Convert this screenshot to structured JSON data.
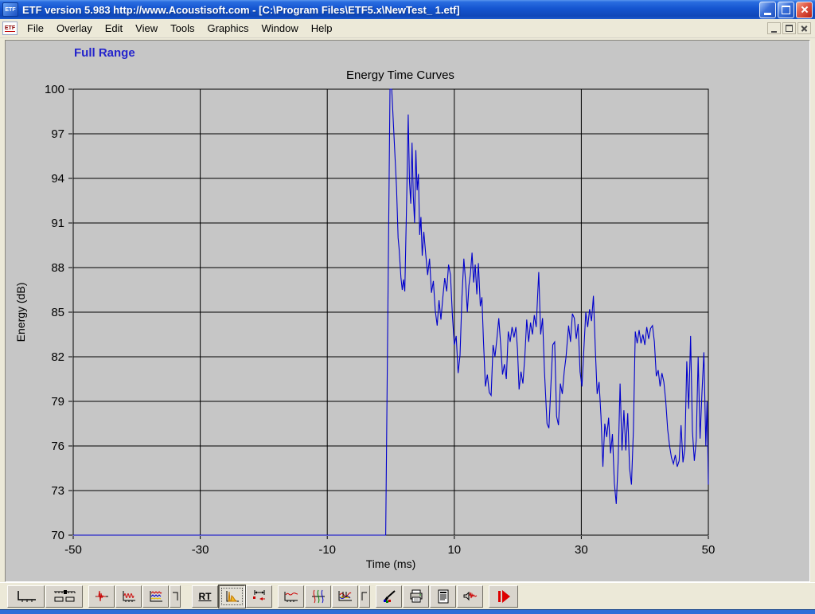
{
  "window": {
    "title": "ETF version 5.983 http://www.Acoustisoft.com - [C:\\Program Files\\ETF5.x\\NewTest_ 1.etf]",
    "icon_text": "ETF"
  },
  "menu": {
    "icon_text": "ETF",
    "items": [
      "File",
      "Overlay",
      "Edit",
      "View",
      "Tools",
      "Graphics",
      "Window",
      "Help"
    ]
  },
  "view_label": "Full Range",
  "chart_data": {
    "type": "line",
    "title": "Energy Time Curves",
    "xlabel": "Time (ms)",
    "ylabel": "Energy (dB)",
    "xlim": [
      -50,
      50
    ],
    "ylim": [
      70,
      100
    ],
    "xticks": [
      -50,
      -30,
      -10,
      10,
      30,
      50
    ],
    "yticks": [
      70,
      73,
      76,
      79,
      82,
      85,
      88,
      91,
      94,
      97,
      100
    ],
    "grid": true,
    "legend": "none",
    "line_color": "#0000cc",
    "series": [
      {
        "name": "Energy",
        "points": [
          [
            -50,
            70
          ],
          [
            -0.8,
            70
          ],
          [
            -0.12,
            100
          ],
          [
            0.15,
            100
          ],
          [
            0.5,
            96.9
          ],
          [
            0.9,
            93.4
          ],
          [
            1.15,
            90.0
          ],
          [
            1.3,
            89.3
          ],
          [
            1.6,
            87.3
          ],
          [
            1.8,
            86.5
          ],
          [
            2.0,
            87.2
          ],
          [
            2.2,
            86.4
          ],
          [
            2.55,
            93.5
          ],
          [
            2.75,
            98.3
          ],
          [
            2.95,
            93.8
          ],
          [
            3.15,
            92.3
          ],
          [
            3.35,
            96.4
          ],
          [
            3.55,
            92.8
          ],
          [
            3.75,
            91.0
          ],
          [
            3.95,
            95.9
          ],
          [
            4.15,
            93.2
          ],
          [
            4.35,
            94.3
          ],
          [
            4.55,
            90.2
          ],
          [
            4.75,
            91.4
          ],
          [
            4.95,
            88.8
          ],
          [
            5.2,
            90.4
          ],
          [
            5.5,
            88.9
          ],
          [
            5.8,
            87.5
          ],
          [
            6.1,
            88.6
          ],
          [
            6.4,
            86.3
          ],
          [
            6.7,
            87.1
          ],
          [
            7.0,
            85.1
          ],
          [
            7.3,
            84.1
          ],
          [
            7.6,
            85.8
          ],
          [
            7.9,
            84.5
          ],
          [
            8.2,
            86.0
          ],
          [
            8.5,
            87.3
          ],
          [
            8.8,
            86.4
          ],
          [
            9.1,
            88.2
          ],
          [
            9.4,
            87.5
          ],
          [
            9.7,
            84.8
          ],
          [
            10.0,
            82.8
          ],
          [
            10.3,
            83.4
          ],
          [
            10.6,
            80.9
          ],
          [
            10.9,
            82.1
          ],
          [
            11.2,
            86.0
          ],
          [
            11.5,
            88.6
          ],
          [
            11.8,
            86.9
          ],
          [
            12.05,
            85.0
          ],
          [
            12.3,
            86.8
          ],
          [
            12.55,
            87.6
          ],
          [
            12.8,
            89.0
          ],
          [
            13.05,
            87.0
          ],
          [
            13.3,
            88.2
          ],
          [
            13.55,
            86.2
          ],
          [
            13.8,
            88.3
          ],
          [
            14.1,
            85.4
          ],
          [
            14.35,
            86.0
          ],
          [
            14.6,
            83.0
          ],
          [
            14.9,
            80.0
          ],
          [
            15.2,
            80.8
          ],
          [
            15.5,
            79.6
          ],
          [
            15.8,
            79.4
          ],
          [
            16.1,
            82.8
          ],
          [
            16.4,
            82.0
          ],
          [
            16.7,
            83.2
          ],
          [
            17.0,
            84.6
          ],
          [
            17.3,
            82.8
          ],
          [
            17.6,
            80.8
          ],
          [
            17.9,
            81.5
          ],
          [
            18.2,
            80.5
          ],
          [
            18.5,
            83.7
          ],
          [
            18.8,
            83.0
          ],
          [
            19.1,
            84.0
          ],
          [
            19.4,
            83.3
          ],
          [
            19.7,
            84.0
          ],
          [
            19.95,
            82.5
          ],
          [
            20.2,
            79.8
          ],
          [
            20.5,
            81.0
          ],
          [
            20.8,
            80.2
          ],
          [
            21.1,
            82.0
          ],
          [
            21.4,
            84.5
          ],
          [
            21.7,
            83.0
          ],
          [
            22.0,
            84.3
          ],
          [
            22.3,
            83.5
          ],
          [
            22.6,
            84.8
          ],
          [
            22.9,
            84.0
          ],
          [
            23.3,
            87.7
          ],
          [
            23.6,
            83.5
          ],
          [
            23.9,
            84.6
          ],
          [
            24.2,
            81.0
          ],
          [
            24.6,
            77.5
          ],
          [
            24.9,
            77.2
          ],
          [
            25.2,
            80.0
          ],
          [
            25.5,
            82.8
          ],
          [
            25.8,
            83.0
          ],
          [
            26.1,
            78.0
          ],
          [
            26.4,
            77.4
          ],
          [
            26.7,
            80.2
          ],
          [
            27.0,
            79.5
          ],
          [
            27.3,
            81.0
          ],
          [
            27.6,
            82.0
          ],
          [
            28.0,
            84.1
          ],
          [
            28.3,
            83.0
          ],
          [
            28.6,
            84.9
          ],
          [
            28.9,
            84.6
          ],
          [
            29.2,
            83.2
          ],
          [
            29.5,
            84.2
          ],
          [
            29.8,
            81.0
          ],
          [
            30.1,
            80.0
          ],
          [
            30.4,
            82.5
          ],
          [
            30.7,
            85.0
          ],
          [
            31.0,
            84.0
          ],
          [
            31.3,
            85.2
          ],
          [
            31.6,
            84.4
          ],
          [
            31.9,
            86.1
          ],
          [
            32.2,
            82.5
          ],
          [
            32.5,
            79.5
          ],
          [
            32.8,
            80.3
          ],
          [
            33.1,
            78.0
          ],
          [
            33.4,
            74.6
          ],
          [
            33.7,
            77.5
          ],
          [
            34.0,
            76.6
          ],
          [
            34.3,
            77.9
          ],
          [
            34.6,
            75.5
          ],
          [
            34.9,
            76.8
          ],
          [
            35.2,
            73.5
          ],
          [
            35.5,
            72.1
          ],
          [
            35.8,
            75.0
          ],
          [
            36.1,
            80.2
          ],
          [
            36.4,
            75.7
          ],
          [
            36.7,
            78.4
          ],
          [
            37.0,
            75.7
          ],
          [
            37.3,
            78.2
          ],
          [
            37.6,
            74.5
          ],
          [
            37.9,
            73.4
          ],
          [
            38.2,
            77.0
          ],
          [
            38.5,
            83.7
          ],
          [
            38.8,
            82.9
          ],
          [
            39.1,
            83.8
          ],
          [
            39.4,
            82.9
          ],
          [
            39.7,
            83.5
          ],
          [
            40.0,
            82.8
          ],
          [
            40.3,
            84.0
          ],
          [
            40.6,
            83.2
          ],
          [
            40.9,
            83.9
          ],
          [
            41.2,
            84.1
          ],
          [
            41.5,
            83.0
          ],
          [
            41.8,
            80.7
          ],
          [
            42.1,
            81.1
          ],
          [
            42.4,
            80.0
          ],
          [
            42.7,
            80.9
          ],
          [
            43.0,
            80.3
          ],
          [
            43.3,
            79.0
          ],
          [
            43.6,
            77.1
          ],
          [
            43.9,
            76.0
          ],
          [
            44.2,
            75.2
          ],
          [
            44.5,
            74.8
          ],
          [
            44.8,
            75.4
          ],
          [
            45.1,
            74.6
          ],
          [
            45.4,
            75.0
          ],
          [
            45.7,
            77.4
          ],
          [
            46.0,
            74.9
          ],
          [
            46.3,
            75.8
          ],
          [
            46.6,
            81.7
          ],
          [
            46.9,
            78.5
          ],
          [
            47.2,
            83.4
          ],
          [
            47.5,
            77.0
          ],
          [
            47.8,
            75.0
          ],
          [
            48.1,
            76.4
          ],
          [
            48.4,
            82.0
          ],
          [
            48.7,
            76.5
          ],
          [
            49.0,
            79.6
          ],
          [
            49.3,
            82.3
          ],
          [
            49.6,
            76.0
          ],
          [
            49.8,
            79.0
          ],
          [
            50.0,
            73.4
          ]
        ]
      }
    ]
  },
  "toolbar": {
    "rt_label": "RT",
    "selected": "energy-time-curve-button",
    "buttons": [
      "axes-button",
      "marker-slider-button",
      "impulse-response-button",
      "wavelet-response-button",
      "overlay-response-button",
      "corner-left-button",
      "rt-button",
      "energy-time-curve-button",
      "time-range-button",
      "frequency-response-button",
      "phase-response-button",
      "combined-response-button",
      "corner-right-button",
      "color-settings-button",
      "print-button",
      "report-button",
      "audio-monitor-button",
      "measure-start-button"
    ]
  },
  "colors": {
    "titlebar_blue": "#1454cf",
    "menu_bg": "#ece9d8",
    "client_gray": "#c6c6c6",
    "curve_blue": "#0000cc",
    "view_label_blue": "#2323cc",
    "close_button_red": "#bb2013",
    "bottom_border_blue": "#2f6fd8"
  }
}
